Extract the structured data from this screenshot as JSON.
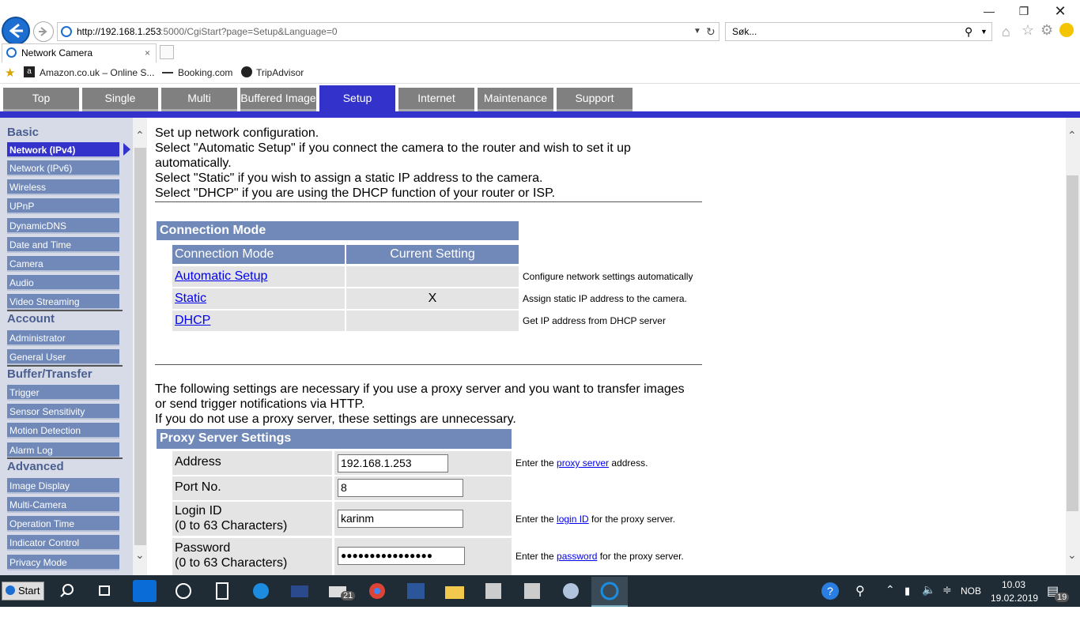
{
  "browser": {
    "url": "http://192.168.1.253:5000/CgiStart?page=Setup&Language=0",
    "url_host": "http://192.168.1.253",
    "url_rest": ":5000/CgiStart?page=Setup&Language=0",
    "search_value": "Søk...",
    "tab_title": "Network Camera",
    "favorites": [
      "Amazon.co.uk – Online S...",
      "Booking.com",
      "TripAdvisor"
    ]
  },
  "topnav": {
    "tabs": [
      "Top",
      "Single",
      "Multi",
      "Buffered Image",
      "Setup",
      "Internet",
      "Maintenance",
      "Support"
    ],
    "active": "Setup"
  },
  "sidebar": {
    "basic_title": "Basic",
    "basic_items": [
      "Network (IPv4)",
      "Network (IPv6)",
      "Wireless",
      "UPnP",
      "DynamicDNS",
      "Date and Time",
      "Camera",
      "Audio",
      "Video Streaming"
    ],
    "account_title": "Account",
    "account_items": [
      "Administrator",
      "General User"
    ],
    "buffer_title": "Buffer/Transfer",
    "buffer_items": [
      "Trigger",
      "Sensor Sensitivity",
      "Motion Detection",
      "Alarm Log"
    ],
    "advanced_title": "Advanced",
    "advanced_items": [
      "Image Display",
      "Multi-Camera",
      "Operation Time",
      "Indicator Control",
      "Privacy Mode"
    ]
  },
  "intro": {
    "line1": "Set up network configuration.",
    "line2": "Select \"Automatic Setup\" if you connect the camera to the router and wish to set it up",
    "line3": "automatically.",
    "line4": "Select \"Static\" if you wish to assign a static IP address to the camera.",
    "line5": "Select \"DHCP\" if you are using the DHCP function of your router or ISP."
  },
  "connection": {
    "title": "Connection Mode",
    "col1": "Connection Mode",
    "col2": "Current Setting",
    "rows": [
      {
        "mode": "Automatic Setup",
        "current": "",
        "hint": "Configure network settings automatically"
      },
      {
        "mode": "Static",
        "current": "X",
        "hint": "Assign static IP address to the camera."
      },
      {
        "mode": "DHCP",
        "current": "",
        "hint": "Get IP address from DHCP server"
      }
    ]
  },
  "proxy_intro": {
    "line1": "The following settings are necessary if you use a proxy server and you want to transfer images",
    "line2": "or send trigger notifications via HTTP.",
    "line3": "If you do not use a proxy server, these settings are unnecessary."
  },
  "proxy": {
    "title": "Proxy Server Settings",
    "address_label": "Address",
    "address_value": "192.168.1.253",
    "address_hint_pre": "Enter the ",
    "address_hint_link": "proxy server",
    "address_hint_post": " address.",
    "port_label": "Port No.",
    "port_value": "8",
    "login_label1": "Login ID",
    "login_label2": "(0 to 63 Characters)",
    "login_value": "karinm",
    "login_hint_pre": "Enter the ",
    "login_hint_link": "login ID",
    "login_hint_post": " for the proxy server.",
    "password_label1": "Password",
    "password_label2": "(0 to 63 Characters)",
    "password_value": "●●●●●●●●●●●●●●●●",
    "password_hint_pre": "Enter the ",
    "password_hint_link": "password",
    "password_hint_post": " for the proxy server."
  },
  "taskbar": {
    "start": "Start",
    "mail_badge": "21",
    "language": "NOB",
    "time": "10.03",
    "date": "19.02.2019",
    "notif_badge": "19"
  },
  "colors": {
    "accent_blue": "#3333cc",
    "table_header": "#7089b8",
    "sidebar_bg": "#d7dbe7",
    "nav_tab": "#808080",
    "taskbar": "#1f2c36"
  },
  "icons": [
    "back-icon",
    "forward-icon",
    "refresh-icon",
    "search-icon",
    "home-icon",
    "star-icon",
    "gear-icon",
    "smiley-icon",
    "ie-icon",
    "new-tab-icon"
  ]
}
